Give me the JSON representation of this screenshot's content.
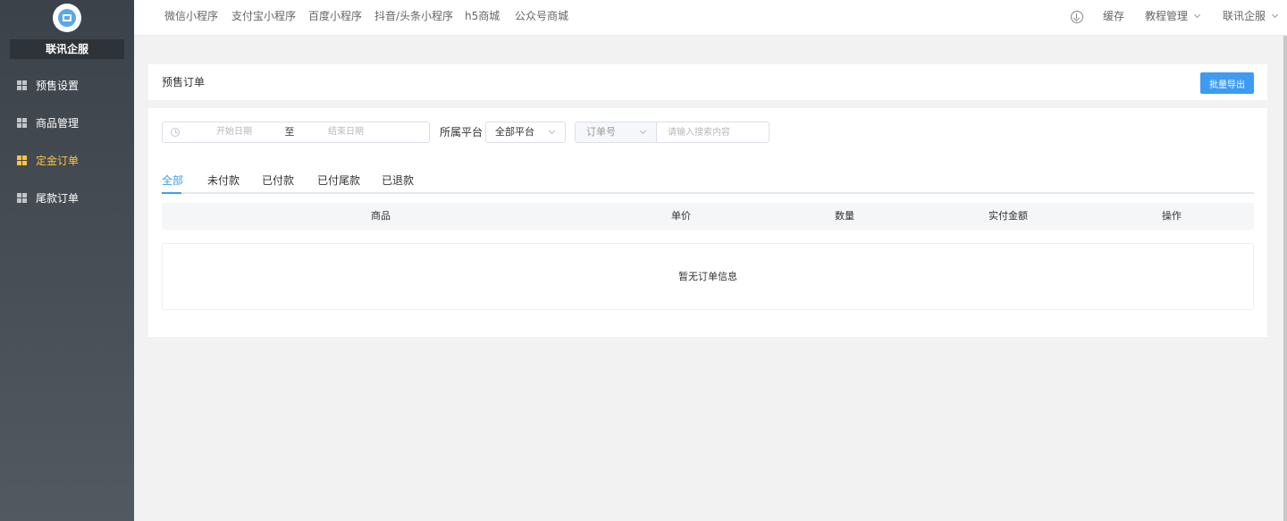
{
  "sidebar": {
    "brand": "联讯企服",
    "items": [
      {
        "label": "预售设置",
        "active": false
      },
      {
        "label": "商品管理",
        "active": false
      },
      {
        "label": "定金订单",
        "active": true
      },
      {
        "label": "尾款订单",
        "active": false
      }
    ]
  },
  "topnav": {
    "links": [
      "微信小程序",
      "支付宝小程序",
      "百度小程序",
      "抖音/头条小程序",
      "h5商城",
      "公众号商城"
    ],
    "cache": "缓存",
    "tutorial": "教程管理",
    "account": "联讯企服"
  },
  "header": {
    "title": "预售订单",
    "export_button": "批量导出"
  },
  "filters": {
    "date_start_placeholder": "开始日期",
    "date_separator": "至",
    "date_end_placeholder": "结束日期",
    "platform_label": "所属平台",
    "platform_value": "全部平台",
    "search_type_value": "订单号",
    "search_placeholder": "请输入搜索内容"
  },
  "tabs": [
    "全部",
    "未付款",
    "已付款",
    "已付尾款",
    "已退款"
  ],
  "active_tab": 0,
  "table": {
    "columns": [
      "商品",
      "单价",
      "数量",
      "实付金额",
      "操作"
    ],
    "empty_text": "暂无订单信息"
  },
  "colors": {
    "accent": "#3d9cf1",
    "sidebar_active": "#ffc53d",
    "sidebar_bg": "#3c424a"
  }
}
